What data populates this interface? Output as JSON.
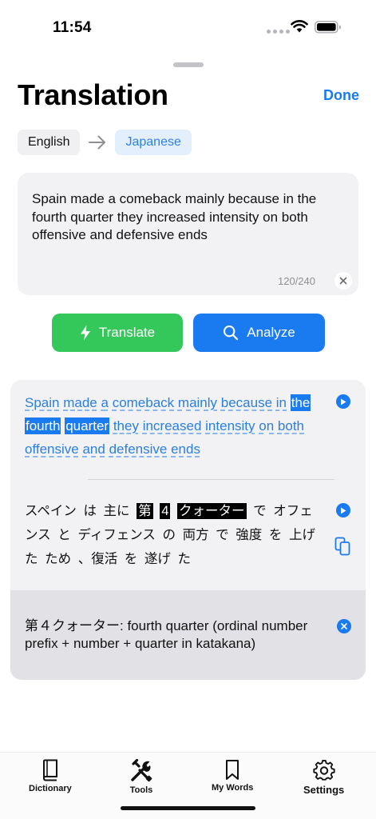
{
  "status_bar": {
    "time": "11:54"
  },
  "header": {
    "title": "Translation",
    "done_label": "Done"
  },
  "languages": {
    "source": "English",
    "target": "Japanese"
  },
  "input": {
    "text": "Spain made a comeback mainly because in the fourth quarter they increased intensity on both offensive and defensive ends",
    "char_count": "120/240"
  },
  "actions": {
    "translate_label": "Translate",
    "analyze_label": "Analyze"
  },
  "result": {
    "source_tokens": [
      {
        "t": "Spain",
        "hl": false
      },
      {
        "t": "made",
        "hl": false
      },
      {
        "t": "a",
        "hl": false
      },
      {
        "t": "comeback",
        "hl": false
      },
      {
        "t": "mainly",
        "hl": false
      },
      {
        "t": "because",
        "hl": false
      },
      {
        "t": "in",
        "hl": false
      },
      {
        "t": "the",
        "hl": true
      },
      {
        "t": "fourth",
        "hl": true
      },
      {
        "t": "quarter",
        "hl": true
      },
      {
        "t": "they",
        "hl": false
      },
      {
        "t": "increased",
        "hl": false
      },
      {
        "t": "intensity",
        "hl": false
      },
      {
        "t": "on",
        "hl": false
      },
      {
        "t": "both",
        "hl": false
      },
      {
        "t": "offensive",
        "hl": false
      },
      {
        "t": "and",
        "hl": false
      },
      {
        "t": "defensive",
        "hl": false
      },
      {
        "t": "ends",
        "hl": false
      }
    ],
    "japanese_tokens": [
      {
        "t": "スペイン",
        "hl": false
      },
      {
        "t": "は",
        "hl": false
      },
      {
        "t": "主に",
        "hl": false
      },
      {
        "t": "第",
        "hl": true
      },
      {
        "t": "4",
        "hl": true
      },
      {
        "t": "クォーター",
        "hl": true
      },
      {
        "t": "で",
        "hl": false
      },
      {
        "t": "オフェンス",
        "hl": false
      },
      {
        "t": "と",
        "hl": false
      },
      {
        "t": "ディフェンス",
        "hl": false
      },
      {
        "t": "の",
        "hl": false
      },
      {
        "t": "両方",
        "hl": false
      },
      {
        "t": "で",
        "hl": false
      },
      {
        "t": "強度",
        "hl": false
      },
      {
        "t": "を",
        "hl": false
      },
      {
        "t": "上げ",
        "hl": false
      },
      {
        "t": "た",
        "hl": false
      },
      {
        "t": "ため",
        "hl": false
      },
      {
        "t": "、復活",
        "hl": false
      },
      {
        "t": "を",
        "hl": false
      },
      {
        "t": "遂げ",
        "hl": false
      },
      {
        "t": "た",
        "hl": false
      }
    ],
    "explanation": "第４クォーター: fourth quarter (ordinal number prefix + number + quarter in katakana)"
  },
  "tabs": [
    {
      "label": "Dictionary",
      "icon": "book-icon"
    },
    {
      "label": "Tools",
      "icon": "tools-icon"
    },
    {
      "label": "My Words",
      "icon": "bookmark-icon"
    },
    {
      "label": "Settings",
      "icon": "gear-icon"
    }
  ],
  "colors": {
    "accent": "#1a7bf0",
    "translate_green": "#34c759",
    "card_bg": "#f2f2f4",
    "explanation_bg": "#e2e2e6",
    "target_chip_bg": "#e3effd"
  }
}
